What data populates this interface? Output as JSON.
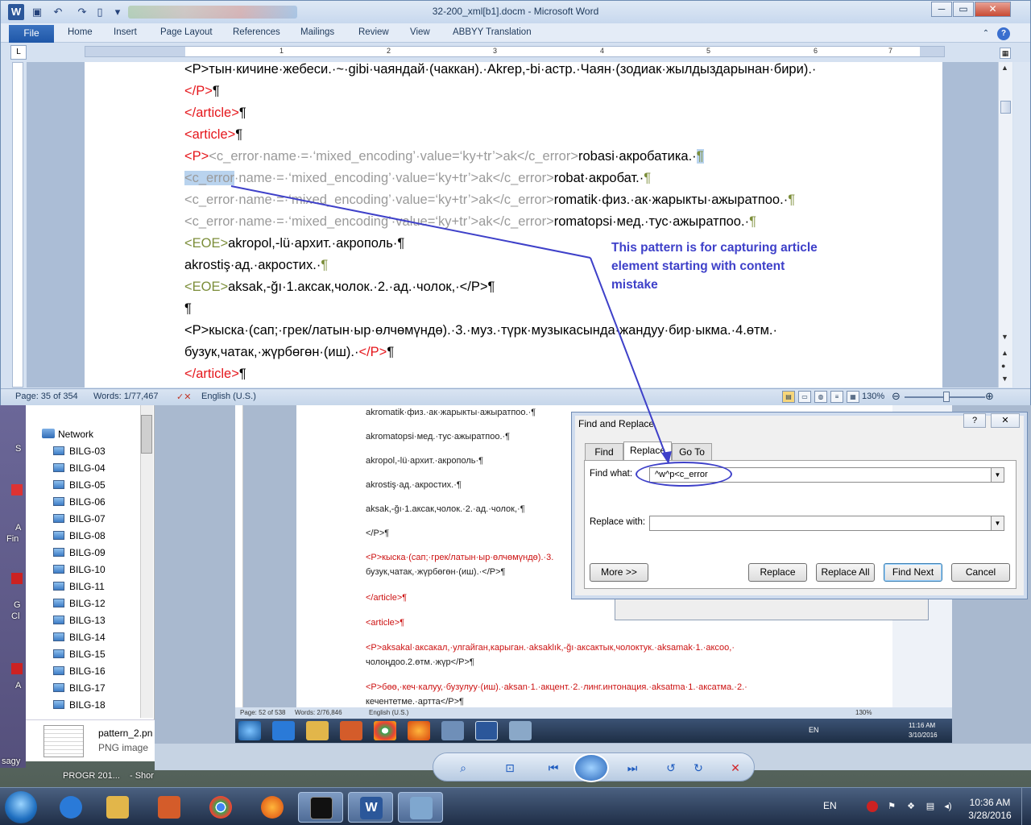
{
  "word": {
    "title": "32-200_xml[b1].docm  -  Microsoft Word",
    "logo": "W",
    "file_tab": "File",
    "tabs": [
      "Home",
      "Insert",
      "Page Layout",
      "References",
      "Mailings",
      "Review",
      "View",
      "ABBYY Translation"
    ],
    "ruler_numbers": [
      "1",
      "2",
      "3",
      "4",
      "5",
      "6",
      "7"
    ],
    "status": {
      "page": "Page: 35 of 354",
      "words": "Words: 1/77,467",
      "language": "English (U.S.)",
      "zoom": "130%"
    },
    "lines": [
      [
        {
          "t": "<P>тын·кичине·жебеси.·~·gibi·чаяндай·(чаккан).·Akrep,-bi·астр.·Чаян·(зодиак·жылдыздарынан·бири).·",
          "c": ""
        }
      ],
      [
        {
          "t": "</P>",
          "c": "red"
        },
        {
          "t": "¶",
          "c": ""
        }
      ],
      [
        {
          "t": "</article>",
          "c": "red"
        },
        {
          "t": "¶",
          "c": ""
        }
      ],
      [
        {
          "t": "<article>",
          "c": "red"
        },
        {
          "t": "¶",
          "c": ""
        }
      ],
      [
        {
          "t": "<P>",
          "c": "red"
        },
        {
          "t": "<c_error·name·=·‘mixed_encoding’·value=‘ky+tr’>ak</c_error>",
          "c": "grey"
        },
        {
          "t": "robasi·акробатика.·",
          "c": ""
        },
        {
          "t": "¶",
          "c": "olive sel"
        }
      ],
      [
        {
          "t": "<c_error",
          "c": "grey sel"
        },
        {
          "t": "·name·=·‘mixed_encoding’·value=‘ky+tr’>ak</c_error>",
          "c": "grey"
        },
        {
          "t": "robat·акробат.·",
          "c": ""
        },
        {
          "t": "¶",
          "c": "olive"
        }
      ],
      [
        {
          "t": "<c_error·name·=·‘mixed_encoding’·value=‘ky+tr’>ak</c_error>",
          "c": "grey"
        },
        {
          "t": "romatik·физ.·ак·жарыкты·ажыратпоо.·",
          "c": ""
        },
        {
          "t": "¶",
          "c": "olive"
        }
      ],
      [
        {
          "t": "<c_error·name·=·‘mixed_encoding’·value=‘ky+tr’>ak</c_error>",
          "c": "grey"
        },
        {
          "t": "romatopsi·мед.·тус·ажыратпоо.·",
          "c": ""
        },
        {
          "t": "¶",
          "c": "olive"
        }
      ],
      [
        {
          "t": "<EOE>",
          "c": "olive"
        },
        {
          "t": "akropol,-lü·архит.·акрополь·¶",
          "c": ""
        }
      ],
      [
        {
          "t": "akrostiş·ад.·акростих.·",
          "c": ""
        },
        {
          "t": "¶",
          "c": "olive"
        }
      ],
      [
        {
          "t": "<EOE>",
          "c": "olive"
        },
        {
          "t": "aksak,-ğı·1.аксак,чолок.·2.·ад.·чолок,·</P>¶",
          "c": ""
        }
      ],
      [
        {
          "t": "¶",
          "c": ""
        }
      ],
      [
        {
          "t": "<P>кыска·(сап;·грек/латын·ыр·өлчөмүндө).·3.·муз.·түрк·музыкасында·жандуу·бир·ыкма.·4.өтм.·",
          "c": ""
        }
      ],
      [
        {
          "t": "бузук,чатак,·жүрбөгөн·(иш).·",
          "c": ""
        },
        {
          "t": "</P>",
          "c": "red"
        },
        {
          "t": "¶",
          "c": ""
        }
      ],
      [
        {
          "t": "</article>",
          "c": "red"
        },
        {
          "t": "¶",
          "c": ""
        }
      ]
    ]
  },
  "annotation": "This pattern is for capturing article element starting with content mistake",
  "dialog": {
    "title": "Find and Replace",
    "help": "?",
    "close": "✕",
    "tabs": [
      "Find",
      "Replace",
      "Go To"
    ],
    "find_label": "Find what:",
    "find_value": "^w^p<c_error",
    "replace_label": "Replace with:",
    "replace_value": "",
    "more_btn": "More >>",
    "replace_btn": "Replace",
    "replace_all_btn": "Replace All",
    "find_next_btn": "Find Next",
    "cancel_btn": "Cancel"
  },
  "explorer": {
    "network_label": "Network",
    "items": [
      "BILG-03",
      "BILG-04",
      "BILG-05",
      "BILG-06",
      "BILG-07",
      "BILG-08",
      "BILG-09",
      "BILG-10",
      "BILG-11",
      "BILG-12",
      "BILG-13",
      "BILG-14",
      "BILG-15",
      "BILG-16",
      "BILG-17",
      "BILG-18"
    ],
    "file_name": "pattern_2.pn",
    "file_type": "PNG image",
    "prog_label": "PROGR 201...",
    "short_label": "- Shor"
  },
  "bg_doc": {
    "lines": [
      "akromatik·физ.·ак·жарыкты·ажыратпоо.·¶",
      "akromatopsi·мед.·тус·ажыратпоо.·¶",
      "akropol,-lü·архит.·акрополь·¶",
      "akrostiş·ад.·акростих.·¶",
      "aksak,-ğı·1.аксак,чолок.·2.·ад.·чолок,·¶",
      "</P>¶",
      "<P>кыска·(сап;·грек/латын·ыр·өлчөмүндө).·3.",
      "бузук,чатак,·жүрбөгөн·(иш).·</P>¶",
      "</article>¶",
      "<article>¶",
      "<P>aksakal·аксакал,·улгайган,карыган.·aksaklık,-ğı·аксактык,чолоктук.·aksamak·1.·аксоо,·",
      "чолоңдоо.2.өтм.·жүр</P>¶",
      "<P>бөө,·кеч·калуу,·бузулуу·(иш).·aksan·1.·акцент.·2.·линг.интонация.·aksatma·1.·аксатма.·2.·",
      "кечентетме.·артта</P>¶"
    ],
    "status_page": "Page: 52 of 538",
    "status_words": "Words: 2/76,846",
    "status_lang": "English (U.S.)",
    "status_zoom": "130%",
    "inner_lang": "EN",
    "inner_time": "11:16 AM",
    "inner_date": "3/10/2016"
  },
  "desktop": {
    "left_labels": [
      "S",
      "A",
      "Fin",
      "G",
      "Cl",
      "A",
      "sagy"
    ]
  },
  "taskbar": {
    "lang": "EN",
    "time": "10:36 AM",
    "date": "3/28/2016"
  }
}
